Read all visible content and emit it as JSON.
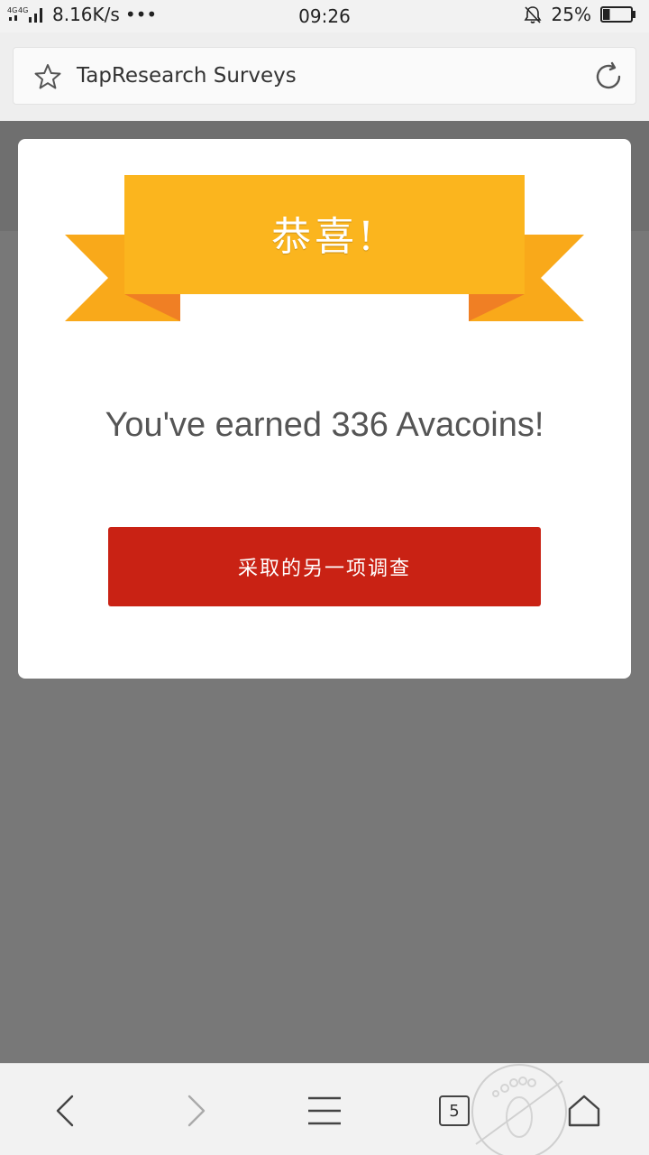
{
  "status_bar": {
    "network_type": "4G 4G",
    "speed": "8.16K/s",
    "more": "•••",
    "time": "09:26",
    "battery_percent": "25%",
    "battery_level": 0.25
  },
  "url_bar": {
    "title": "TapResearch Surveys"
  },
  "card": {
    "banner_text": "恭喜!",
    "earned_text": "You've earned 336 Avacoins!",
    "cta_label": "采取的另一项调查"
  },
  "nav": {
    "tabs_count": "5"
  },
  "colors": {
    "ribbon": "#fbb51e",
    "ribbon_dark": "#f07f24",
    "cta": "#c92214",
    "overlay": "#787878"
  }
}
